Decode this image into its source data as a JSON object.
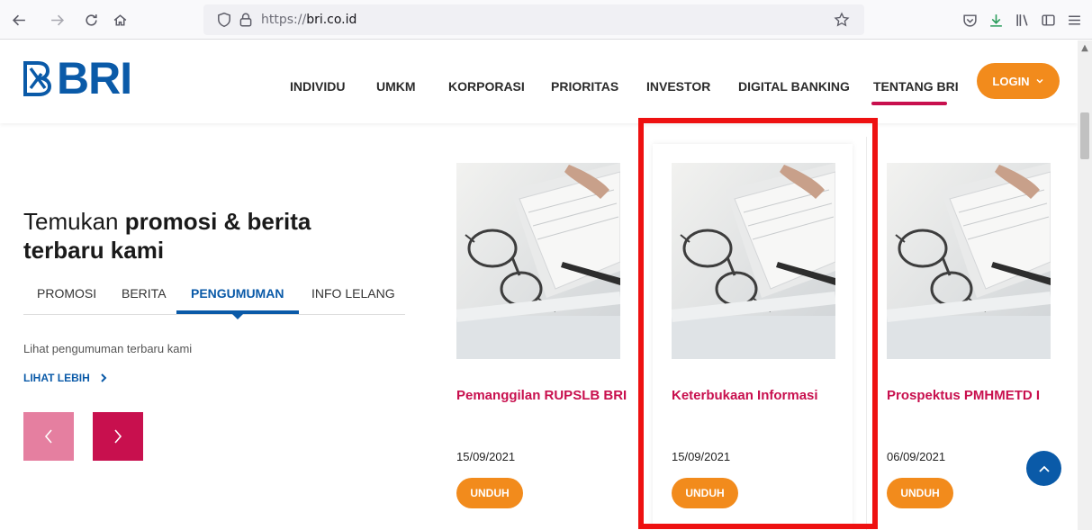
{
  "browser": {
    "url_prefix": "https://",
    "url_host": "bri.co.id"
  },
  "site": {
    "logo_text": "BRI",
    "menu": [
      {
        "label": "INDIVIDU"
      },
      {
        "label": "UMKM"
      },
      {
        "label": "KORPORASI"
      },
      {
        "label": "PRIORITAS"
      },
      {
        "label": "INVESTOR"
      },
      {
        "label": "DIGITAL BANKING"
      },
      {
        "label": "TENTANG BRI"
      }
    ],
    "login_label": "LOGIN"
  },
  "hero": {
    "title_plain": "Temukan ",
    "title_bold_1": "promosi & berita",
    "title_bold_2": "terbaru kami",
    "tabs": [
      {
        "label": "PROMOSI"
      },
      {
        "label": "BERITA"
      },
      {
        "label": "PENGUMUMAN"
      },
      {
        "label": "INFO LELANG"
      }
    ],
    "subtitle": "Lihat pengumuman terbaru kami",
    "more_label": "LIHAT LEBIH"
  },
  "cards": [
    {
      "title": "Pemanggilan RUPSLB BRI",
      "date": "15/09/2021",
      "button": "UNDUH"
    },
    {
      "title": "Keterbukaan Informasi",
      "date": "15/09/2021",
      "button": "UNDUH"
    },
    {
      "title": "Prospektus PMHMETD I",
      "date": "06/09/2021",
      "button": "UNDUH"
    }
  ],
  "colors": {
    "brand_blue": "#0a5aa8",
    "brand_red": "#c8104e",
    "accent_orange": "#f28b1c",
    "highlight_red": "#ee1111"
  }
}
